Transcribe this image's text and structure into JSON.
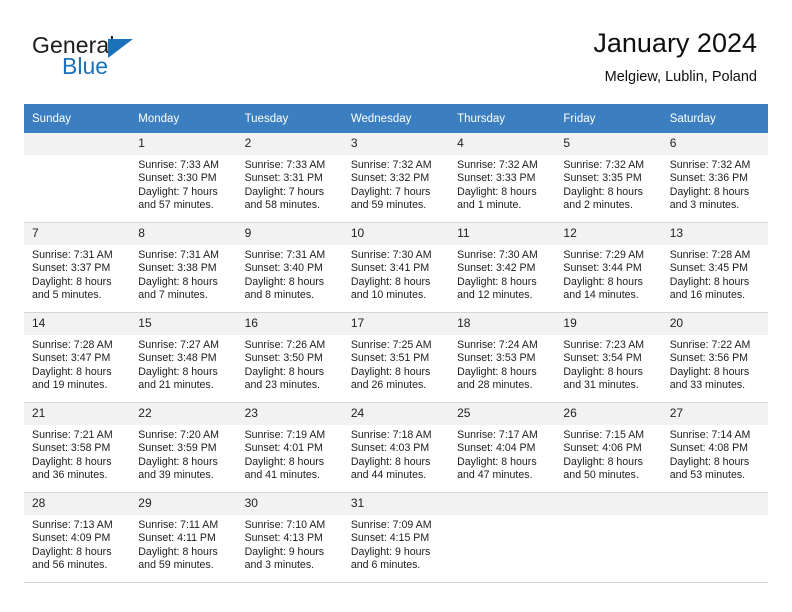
{
  "brand": {
    "name_part1": "General",
    "name_part2": "Blue",
    "accent_color": "#1b72bb"
  },
  "header": {
    "title": "January 2024",
    "subtitle": "Melgiew, Lublin, Poland"
  },
  "calendar": {
    "header_bg": "#3c7fc1",
    "daynum_bg": "#f2f2f2",
    "weekday_headers": [
      "Sunday",
      "Monday",
      "Tuesday",
      "Wednesday",
      "Thursday",
      "Friday",
      "Saturday"
    ],
    "weeks": [
      [
        {
          "day": "",
          "lines": []
        },
        {
          "day": "1",
          "lines": [
            "Sunrise: 7:33 AM",
            "Sunset: 3:30 PM",
            "Daylight: 7 hours",
            "and 57 minutes."
          ]
        },
        {
          "day": "2",
          "lines": [
            "Sunrise: 7:33 AM",
            "Sunset: 3:31 PM",
            "Daylight: 7 hours",
            "and 58 minutes."
          ]
        },
        {
          "day": "3",
          "lines": [
            "Sunrise: 7:32 AM",
            "Sunset: 3:32 PM",
            "Daylight: 7 hours",
            "and 59 minutes."
          ]
        },
        {
          "day": "4",
          "lines": [
            "Sunrise: 7:32 AM",
            "Sunset: 3:33 PM",
            "Daylight: 8 hours",
            "and 1 minute."
          ]
        },
        {
          "day": "5",
          "lines": [
            "Sunrise: 7:32 AM",
            "Sunset: 3:35 PM",
            "Daylight: 8 hours",
            "and 2 minutes."
          ]
        },
        {
          "day": "6",
          "lines": [
            "Sunrise: 7:32 AM",
            "Sunset: 3:36 PM",
            "Daylight: 8 hours",
            "and 3 minutes."
          ]
        }
      ],
      [
        {
          "day": "7",
          "lines": [
            "Sunrise: 7:31 AM",
            "Sunset: 3:37 PM",
            "Daylight: 8 hours",
            "and 5 minutes."
          ]
        },
        {
          "day": "8",
          "lines": [
            "Sunrise: 7:31 AM",
            "Sunset: 3:38 PM",
            "Daylight: 8 hours",
            "and 7 minutes."
          ]
        },
        {
          "day": "9",
          "lines": [
            "Sunrise: 7:31 AM",
            "Sunset: 3:40 PM",
            "Daylight: 8 hours",
            "and 8 minutes."
          ]
        },
        {
          "day": "10",
          "lines": [
            "Sunrise: 7:30 AM",
            "Sunset: 3:41 PM",
            "Daylight: 8 hours",
            "and 10 minutes."
          ]
        },
        {
          "day": "11",
          "lines": [
            "Sunrise: 7:30 AM",
            "Sunset: 3:42 PM",
            "Daylight: 8 hours",
            "and 12 minutes."
          ]
        },
        {
          "day": "12",
          "lines": [
            "Sunrise: 7:29 AM",
            "Sunset: 3:44 PM",
            "Daylight: 8 hours",
            "and 14 minutes."
          ]
        },
        {
          "day": "13",
          "lines": [
            "Sunrise: 7:28 AM",
            "Sunset: 3:45 PM",
            "Daylight: 8 hours",
            "and 16 minutes."
          ]
        }
      ],
      [
        {
          "day": "14",
          "lines": [
            "Sunrise: 7:28 AM",
            "Sunset: 3:47 PM",
            "Daylight: 8 hours",
            "and 19 minutes."
          ]
        },
        {
          "day": "15",
          "lines": [
            "Sunrise: 7:27 AM",
            "Sunset: 3:48 PM",
            "Daylight: 8 hours",
            "and 21 minutes."
          ]
        },
        {
          "day": "16",
          "lines": [
            "Sunrise: 7:26 AM",
            "Sunset: 3:50 PM",
            "Daylight: 8 hours",
            "and 23 minutes."
          ]
        },
        {
          "day": "17",
          "lines": [
            "Sunrise: 7:25 AM",
            "Sunset: 3:51 PM",
            "Daylight: 8 hours",
            "and 26 minutes."
          ]
        },
        {
          "day": "18",
          "lines": [
            "Sunrise: 7:24 AM",
            "Sunset: 3:53 PM",
            "Daylight: 8 hours",
            "and 28 minutes."
          ]
        },
        {
          "day": "19",
          "lines": [
            "Sunrise: 7:23 AM",
            "Sunset: 3:54 PM",
            "Daylight: 8 hours",
            "and 31 minutes."
          ]
        },
        {
          "day": "20",
          "lines": [
            "Sunrise: 7:22 AM",
            "Sunset: 3:56 PM",
            "Daylight: 8 hours",
            "and 33 minutes."
          ]
        }
      ],
      [
        {
          "day": "21",
          "lines": [
            "Sunrise: 7:21 AM",
            "Sunset: 3:58 PM",
            "Daylight: 8 hours",
            "and 36 minutes."
          ]
        },
        {
          "day": "22",
          "lines": [
            "Sunrise: 7:20 AM",
            "Sunset: 3:59 PM",
            "Daylight: 8 hours",
            "and 39 minutes."
          ]
        },
        {
          "day": "23",
          "lines": [
            "Sunrise: 7:19 AM",
            "Sunset: 4:01 PM",
            "Daylight: 8 hours",
            "and 41 minutes."
          ]
        },
        {
          "day": "24",
          "lines": [
            "Sunrise: 7:18 AM",
            "Sunset: 4:03 PM",
            "Daylight: 8 hours",
            "and 44 minutes."
          ]
        },
        {
          "day": "25",
          "lines": [
            "Sunrise: 7:17 AM",
            "Sunset: 4:04 PM",
            "Daylight: 8 hours",
            "and 47 minutes."
          ]
        },
        {
          "day": "26",
          "lines": [
            "Sunrise: 7:15 AM",
            "Sunset: 4:06 PM",
            "Daylight: 8 hours",
            "and 50 minutes."
          ]
        },
        {
          "day": "27",
          "lines": [
            "Sunrise: 7:14 AM",
            "Sunset: 4:08 PM",
            "Daylight: 8 hours",
            "and 53 minutes."
          ]
        }
      ],
      [
        {
          "day": "28",
          "lines": [
            "Sunrise: 7:13 AM",
            "Sunset: 4:09 PM",
            "Daylight: 8 hours",
            "and 56 minutes."
          ]
        },
        {
          "day": "29",
          "lines": [
            "Sunrise: 7:11 AM",
            "Sunset: 4:11 PM",
            "Daylight: 8 hours",
            "and 59 minutes."
          ]
        },
        {
          "day": "30",
          "lines": [
            "Sunrise: 7:10 AM",
            "Sunset: 4:13 PM",
            "Daylight: 9 hours",
            "and 3 minutes."
          ]
        },
        {
          "day": "31",
          "lines": [
            "Sunrise: 7:09 AM",
            "Sunset: 4:15 PM",
            "Daylight: 9 hours",
            "and 6 minutes."
          ]
        },
        {
          "day": "",
          "lines": []
        },
        {
          "day": "",
          "lines": []
        },
        {
          "day": "",
          "lines": []
        }
      ]
    ]
  }
}
